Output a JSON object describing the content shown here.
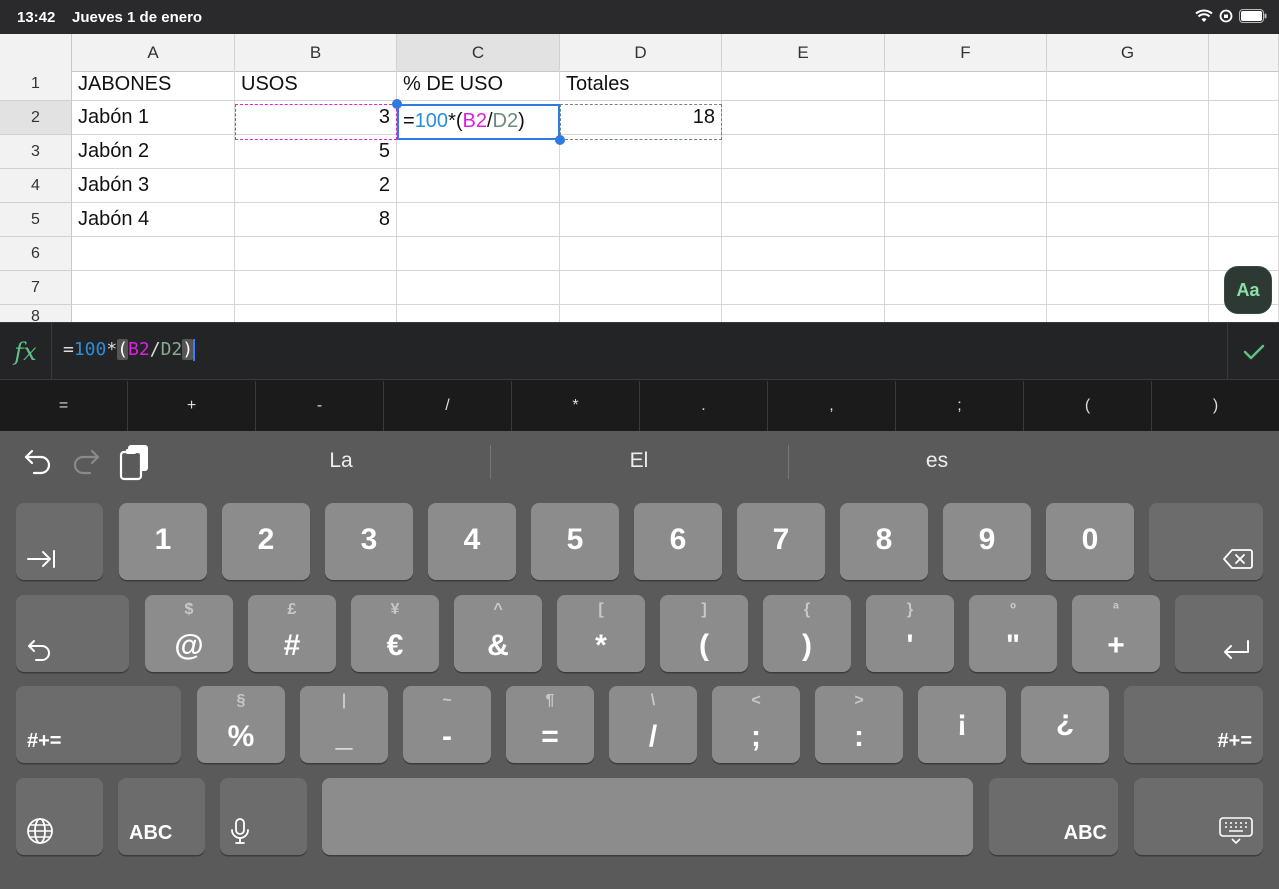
{
  "status_bar": {
    "time": "13:42",
    "date": "Jueves 1 de enero"
  },
  "sheet": {
    "columns": [
      "A",
      "B",
      "C",
      "D",
      "E",
      "F",
      "G"
    ],
    "rows": [
      "1",
      "2",
      "3",
      "4",
      "5",
      "6",
      "7",
      "8"
    ],
    "cells": {
      "A1": "JABONES",
      "B1": "USOS",
      "C1": "% DE USO",
      "D1": "Totales",
      "A2": "Jabón 1",
      "B2": "3",
      "D2": "18",
      "A3": "Jabón 2",
      "B3": "5",
      "A4": "Jabón 3",
      "B4": "2",
      "A5": "Jabón 4",
      "B5": "8"
    },
    "editing_cell": {
      "ref": "C2",
      "parts": [
        "=",
        "100",
        "*(",
        "B2",
        "/",
        "D2",
        ")"
      ]
    },
    "colors": {
      "number": "#2b8ed8",
      "ref_b2": "#e020e0",
      "ref_d2": "#6c8a78",
      "selection": "#2f7be0"
    }
  },
  "format_button": {
    "label": "Aa"
  },
  "formula_bar": {
    "fx": "fx",
    "parts": [
      "=",
      "100",
      "*",
      "(",
      "B2",
      "/",
      "D2",
      ")"
    ]
  },
  "operators": [
    "=",
    "+",
    "-",
    "/",
    "*",
    ".",
    ",",
    ";",
    "(",
    ")"
  ],
  "keyboard": {
    "suggestions": [
      "La",
      "El",
      "es"
    ],
    "numbers": [
      "1",
      "2",
      "3",
      "4",
      "5",
      "6",
      "7",
      "8",
      "9",
      "0"
    ],
    "row2": [
      {
        "main": "@",
        "alt": "$"
      },
      {
        "main": "#",
        "alt": "£"
      },
      {
        "main": "€",
        "alt": "¥"
      },
      {
        "main": "&",
        "alt": "^"
      },
      {
        "main": "*",
        "alt": "["
      },
      {
        "main": "(",
        "alt": "]"
      },
      {
        "main": ")",
        "alt": "{"
      },
      {
        "main": "'",
        "alt": "}"
      },
      {
        "main": "\"",
        "alt": "º"
      },
      {
        "main": "+",
        "alt": "ª"
      }
    ],
    "row3": [
      {
        "main": "%",
        "alt": "§"
      },
      {
        "main": "_",
        "alt": "|"
      },
      {
        "main": "-",
        "alt": "~"
      },
      {
        "main": "=",
        "alt": "¶"
      },
      {
        "main": "/",
        "alt": "\\"
      },
      {
        "main": ";",
        "alt": "<"
      },
      {
        "main": ":",
        "alt": ">"
      },
      {
        "main": "¡",
        "alt": ""
      },
      {
        "main": "¿",
        "alt": ""
      }
    ],
    "symbols_left": "#+=",
    "symbols_right": "#+=",
    "abc_left": "ABC",
    "abc_right": "ABC"
  }
}
